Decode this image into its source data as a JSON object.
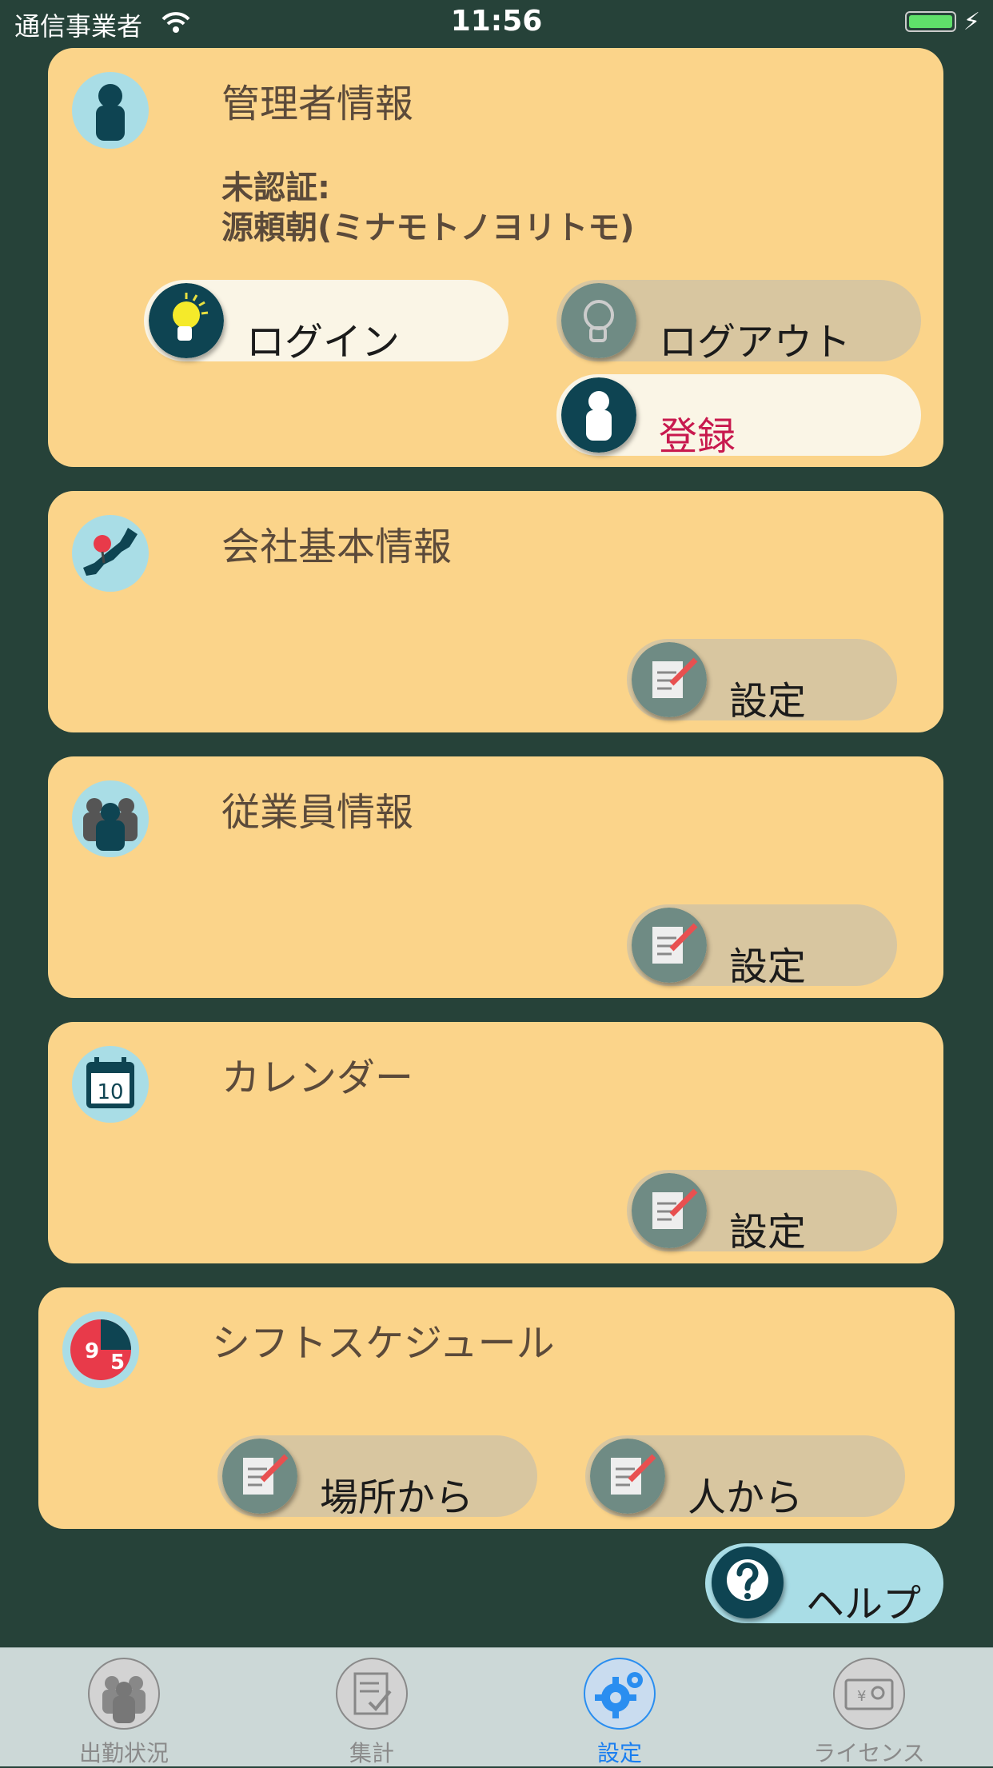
{
  "status_bar": {
    "carrier": "通信事業者",
    "time": "11:56"
  },
  "admin": {
    "title": "管理者情報",
    "status_line": "未認証:",
    "name_line": "源頼朝(ミナモトノヨリトモ)",
    "login_label": "ログイン",
    "logout_label": "ログアウト",
    "register_label": "登録"
  },
  "company": {
    "title": "会社基本情報",
    "settings_label": "設定"
  },
  "employees": {
    "title": "従業員情報",
    "settings_label": "設定"
  },
  "calendar": {
    "title": "カレンダー",
    "settings_label": "設定",
    "calendar_day": "10"
  },
  "shift": {
    "title": "シフトスケジュール",
    "by_location_label": "場所から",
    "by_person_label": "人から",
    "icon_start": "9",
    "icon_end": "5"
  },
  "help": {
    "label": "ヘルプ"
  },
  "tabs": [
    {
      "label": "出勤状況",
      "icon": "people-icon",
      "active": false
    },
    {
      "label": "集計",
      "icon": "checklist-icon",
      "active": false
    },
    {
      "label": "設定",
      "icon": "gear-icon",
      "active": true
    },
    {
      "label": "ライセンス",
      "icon": "license-icon",
      "active": false
    }
  ],
  "colors": {
    "background": "#264239",
    "card": "#fbd48a",
    "accent_active_tab": "#1a7ef0",
    "register_text": "#c8194e"
  }
}
